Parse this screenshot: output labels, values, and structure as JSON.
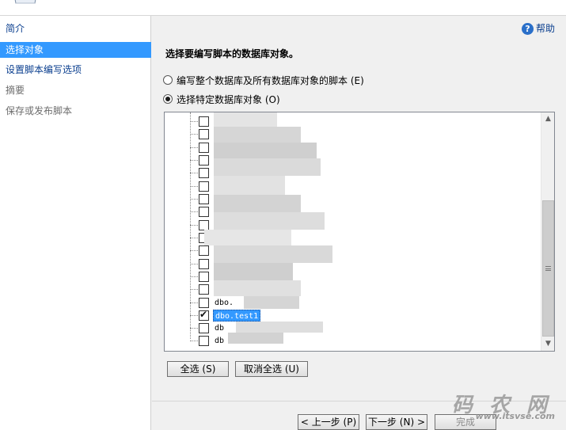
{
  "nav": {
    "items": [
      {
        "label": "简介"
      },
      {
        "label": "选择对象"
      },
      {
        "label": "设置脚本编写选项"
      },
      {
        "label": "摘要"
      },
      {
        "label": "保存或发布脚本"
      }
    ]
  },
  "main": {
    "help_label": "帮助",
    "title": "选择要编写脚本的数据库对象。",
    "option_whole_db": "编写整个数据库及所有数据库对象的脚本 (E)",
    "option_specific": "选择特定数据库对象 (O)",
    "tree": {
      "partial_label_1": "dbo.",
      "selected_label": "dbo.test1",
      "partial_label_2": "db",
      "partial_label_3": "db"
    },
    "select_all": "全选 (S)",
    "deselect_all": "取消全选 (U)"
  },
  "footer": {
    "prev": "< 上一步 (P)",
    "next": "下一步 (N) >",
    "finish": "完成"
  },
  "watermark": {
    "text": "码 农 网",
    "url": "www.itsvse.com"
  }
}
